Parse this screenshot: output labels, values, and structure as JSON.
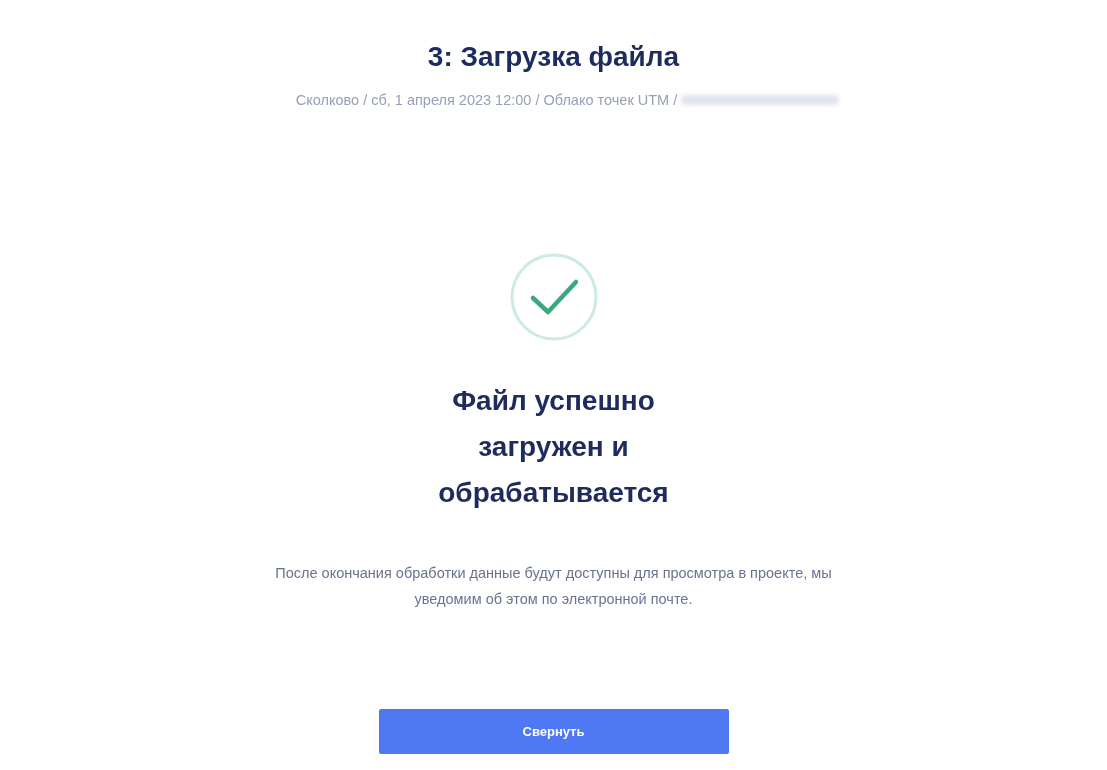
{
  "title": "3: Загрузка файла",
  "breadcrumb": "Сколково / сб, 1 апреля 2023 12:00 / Облако точек UTM /",
  "status": {
    "kind": "success",
    "heading": "Файл успешно загружен и обрабатывается",
    "message": "После окончания обработки данные будут доступны для просмотра в проекте, мы уведомим об этом по электронной почте."
  },
  "button": {
    "label": "Свернуть"
  }
}
